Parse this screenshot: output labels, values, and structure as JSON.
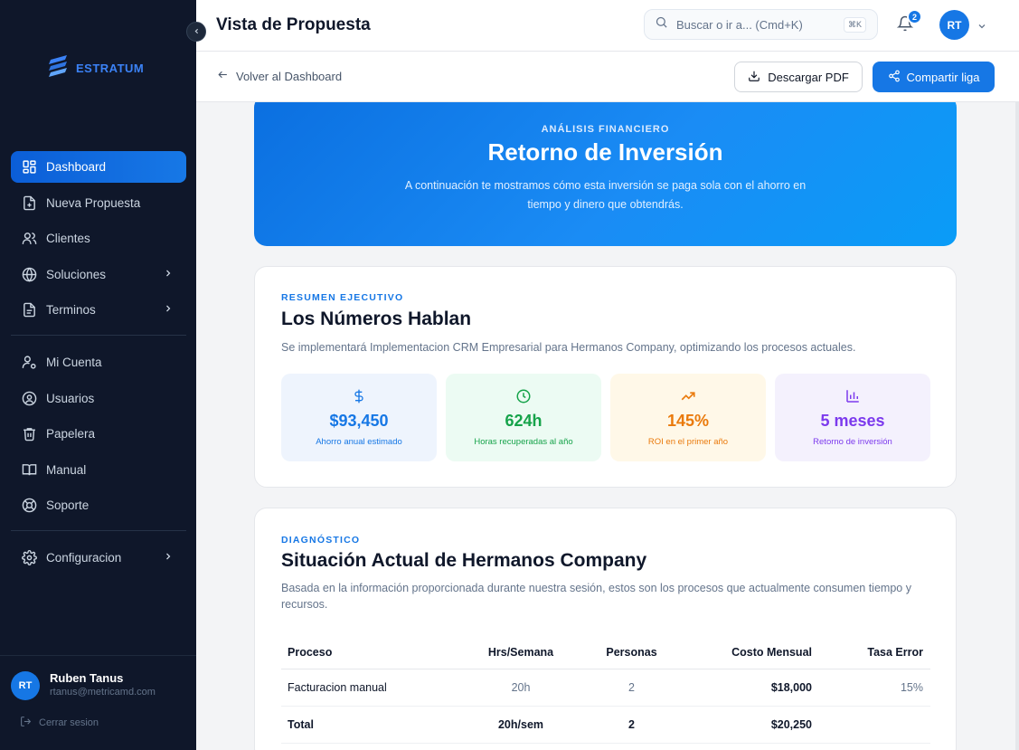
{
  "brand": {
    "name": "ESTRATUM"
  },
  "sidebar": {
    "items": [
      {
        "label": "Dashboard"
      },
      {
        "label": "Nueva Propuesta"
      },
      {
        "label": "Clientes"
      },
      {
        "label": "Soluciones"
      },
      {
        "label": "Terminos"
      },
      {
        "label": "Mi Cuenta"
      },
      {
        "label": "Usuarios"
      },
      {
        "label": "Papelera"
      },
      {
        "label": "Manual"
      },
      {
        "label": "Soporte"
      },
      {
        "label": "Configuracion"
      }
    ],
    "user": {
      "initials": "RT",
      "name": "Ruben Tanus",
      "email": "rtanus@metricamd.com"
    },
    "logout_label": "Cerrar sesion"
  },
  "header": {
    "title": "Vista de Propuesta",
    "search_placeholder": "Buscar o ir a... (Cmd+K)",
    "search_shortcut": "⌘K",
    "notifications_count": "2",
    "avatar_initials": "RT"
  },
  "subheader": {
    "back_label": "Volver al Dashboard",
    "pdf_label": "Descargar PDF",
    "share_label": "Compartir liga"
  },
  "hero": {
    "kicker": "ANÁLISIS FINANCIERO",
    "title": "Retorno de Inversión",
    "description": "A continuación te mostramos cómo esta inversión se paga sola con el ahorro en tiempo y dinero que obtendrás."
  },
  "summary": {
    "kicker": "RESUMEN EJECUTIVO",
    "title": "Los Números Hablan",
    "description": "Se implementará Implementacion CRM Empresarial para Hermanos Company, optimizando los procesos actuales.",
    "metrics": [
      {
        "value": "$93,450",
        "label": "Ahorro anual estimado",
        "color": "#1677e5",
        "bg": "#eef4fd",
        "icon": "dollar-icon"
      },
      {
        "value": "624h",
        "label": "Horas recuperadas al año",
        "color": "#16a34a",
        "bg": "#ecfbf3",
        "icon": "clock-icon"
      },
      {
        "value": "145%",
        "label": "ROI en el primer año",
        "color": "#ea7a0c",
        "bg": "#fff8e8",
        "icon": "trending-up-icon"
      },
      {
        "value": "5 meses",
        "label": "Retorno de inversión",
        "color": "#7c3aed",
        "bg": "#f4f1fd",
        "icon": "bar-chart-icon"
      }
    ]
  },
  "diagnosis": {
    "kicker": "DIAGNÓSTICO",
    "title": "Situación Actual de Hermanos Company",
    "description": "Basada en la información proporcionada durante nuestra sesión, estos son los procesos que actualmente consumen tiempo y recursos.",
    "columns": [
      "Proceso",
      "Hrs/Semana",
      "Personas",
      "Costo Mensual",
      "Tasa Error"
    ],
    "rows": [
      {
        "proceso": "Facturacion manual",
        "hrs": "20h",
        "personas": "2",
        "costo": "$18,000",
        "error": "15%"
      }
    ],
    "total": {
      "proceso": "Total",
      "hrs": "20h/sem",
      "personas": "2",
      "costo": "$20,250",
      "error": ""
    }
  }
}
